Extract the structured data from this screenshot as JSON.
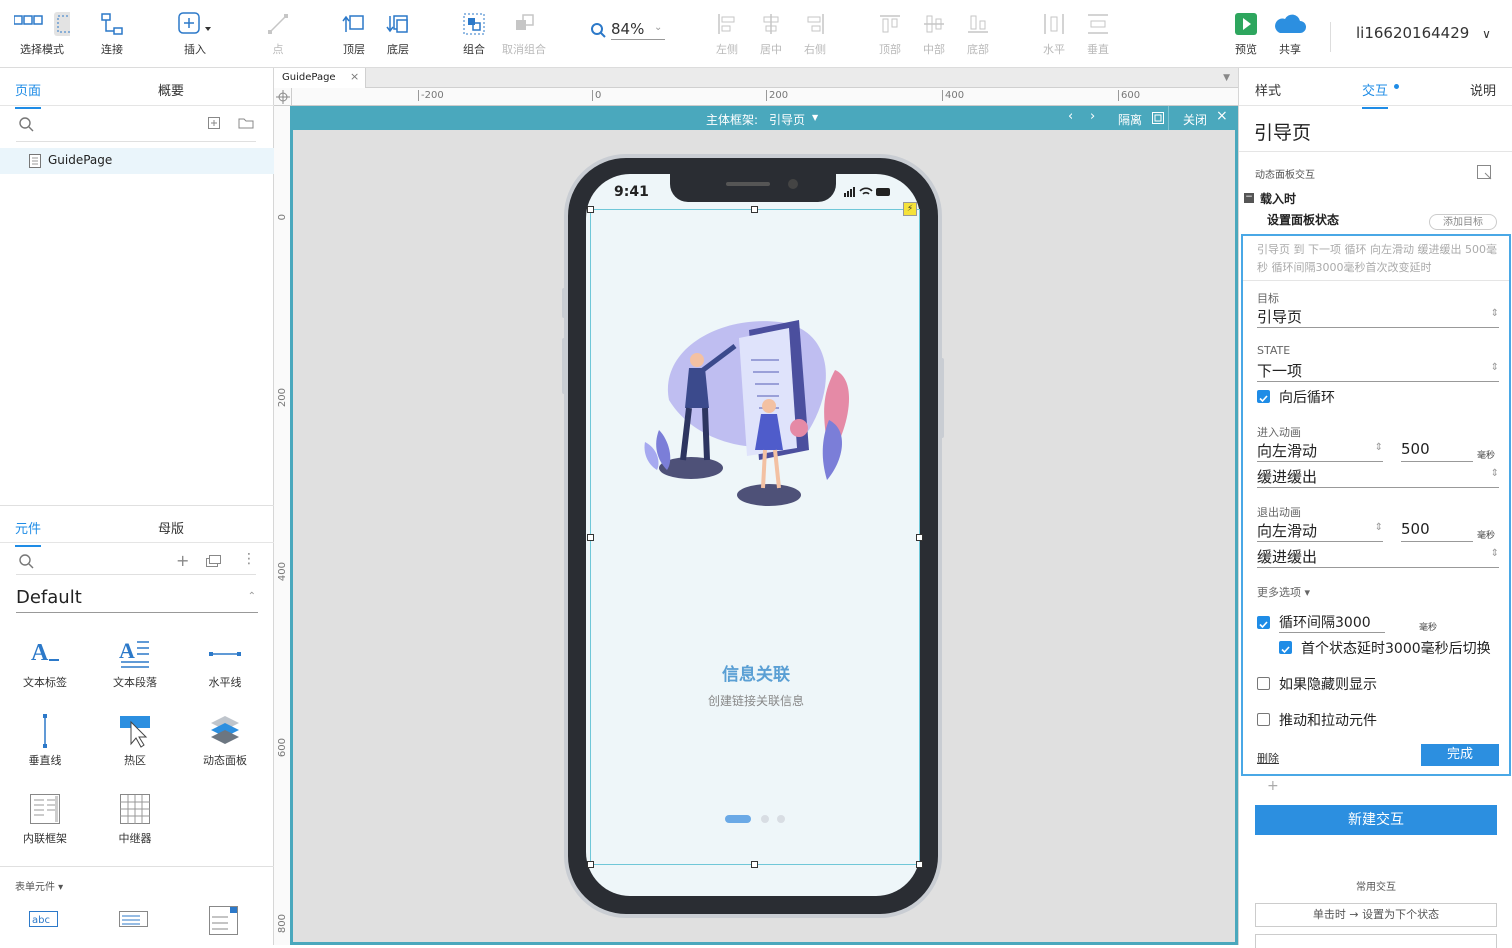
{
  "toolbar": {
    "select_mode": "选择模式",
    "connect": "连接",
    "insert": "插入",
    "point": "点",
    "top_layer": "顶层",
    "bottom_layer": "底层",
    "group": "组合",
    "ungroup": "取消组合",
    "zoom": "84%",
    "align_left": "左侧",
    "align_center": "居中",
    "align_right": "右侧",
    "align_top": "顶部",
    "align_middle": "中部",
    "align_bottom": "底部",
    "dist_h": "水平",
    "dist_v": "垂直",
    "preview": "预览",
    "share": "共享",
    "user": "li16620164429"
  },
  "left": {
    "tab_pages": "页面",
    "tab_outline": "概要",
    "page_item": "GuidePage",
    "tab_widgets": "元件",
    "tab_masters": "母版",
    "library": "Default",
    "widgets": [
      {
        "label": "文本标签",
        "icon": "text-label-icon"
      },
      {
        "label": "文本段落",
        "icon": "text-paragraph-icon"
      },
      {
        "label": "水平线",
        "icon": "horizontal-line-icon"
      },
      {
        "label": "垂直线",
        "icon": "vertical-line-icon"
      },
      {
        "label": "热区",
        "icon": "hotspot-icon"
      },
      {
        "label": "动态面板",
        "icon": "dynamic-panel-icon"
      },
      {
        "label": "内联框架",
        "icon": "inline-frame-icon"
      },
      {
        "label": "中继器",
        "icon": "repeater-icon"
      }
    ],
    "form_section": "表单元件 ▾"
  },
  "canvas": {
    "doc_tab": "GuidePage",
    "ruler_h": [
      "-200",
      "0",
      "200",
      "400",
      "600"
    ],
    "ruler_v": [
      "0",
      "200",
      "400",
      "600",
      "800"
    ],
    "frame_title_label": "主体框架:",
    "frame_title_value": "引导页",
    "isolate": "隔离",
    "close": "关闭",
    "phone_time": "9:41",
    "headline": "信息关联",
    "subline": "创建链接关联信息"
  },
  "right": {
    "tab_style": "样式",
    "tab_interact": "交互",
    "tab_notes": "说明",
    "widget_name": "引导页",
    "section": "动态面板交互",
    "event": "载入时",
    "action": "设置面板状态",
    "add_target": "添加目标",
    "summary": "引导页 到 下一项 循环 向左滑动 缓进缓出 500毫秒 循环间隔3000毫秒首次改变延时",
    "target_label": "目标",
    "target_value": "引导页",
    "state_label": "STATE",
    "state_value": "下一项",
    "wrap_label": "向后循环",
    "enter_anim_label": "进入动画",
    "enter_anim": "向左滑动",
    "enter_ms": "500",
    "enter_ease": "缓进缓出",
    "exit_anim_label": "退出动画",
    "exit_anim": "向左滑动",
    "exit_ms": "500",
    "exit_ease": "缓进缓出",
    "ms_unit": "毫秒",
    "more_options": "更多选项 ▾",
    "loop_interval": "循环间隔3000",
    "first_delay": "首个状态延时3000毫秒后切换",
    "show_if_hidden": "如果隐藏则显示",
    "push_pull": "推动和拉动元件",
    "delete": "删除",
    "done": "完成",
    "new_interaction": "新建交互",
    "common": "常用交互",
    "common_item": "单击时 → 设置为下个状态"
  },
  "colors": {
    "accent": "#1f8ce6",
    "frame": "#4aa8bd",
    "canvas_bg": "#e8e8e8",
    "phone_screen": "#eef6f9",
    "headline": "#5a9fd4"
  }
}
